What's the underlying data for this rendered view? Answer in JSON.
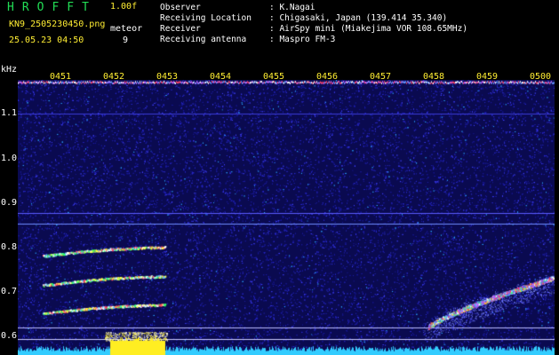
{
  "header": {
    "title": "HROFFT",
    "version": "1.00f",
    "filename": "KN9_2505230450.png",
    "datetime": "25.05.23 04:50",
    "meteor_label": "meteor",
    "meteor_count": "9"
  },
  "info": [
    {
      "key": "Observer",
      "value": ": K.Nagai"
    },
    {
      "key": "Receiving Location",
      "value": ": Chigasaki, Japan (139.414 35.340)"
    },
    {
      "key": "Receiver",
      "value": ": AirSpy mini (Miakejima VOR 108.65MHz)"
    },
    {
      "key": "Receiving antenna",
      "value": ": Maspro FM-3"
    }
  ],
  "axes": {
    "y_unit": "kHz",
    "time_labels": [
      "0451",
      "0452",
      "0453",
      "0454",
      "0455",
      "0456",
      "0457",
      "0458",
      "0459",
      "0500"
    ],
    "freq_ticks": [
      "1.1",
      "1.0",
      "0.9",
      "0.8",
      "0.7",
      "0.6"
    ]
  },
  "colors": {
    "title": "#22dd55",
    "accent": "#ffee33",
    "text": "#ffffff",
    "background_noise": "#1a1a8c",
    "baseline_noise": "#33ccff"
  }
}
